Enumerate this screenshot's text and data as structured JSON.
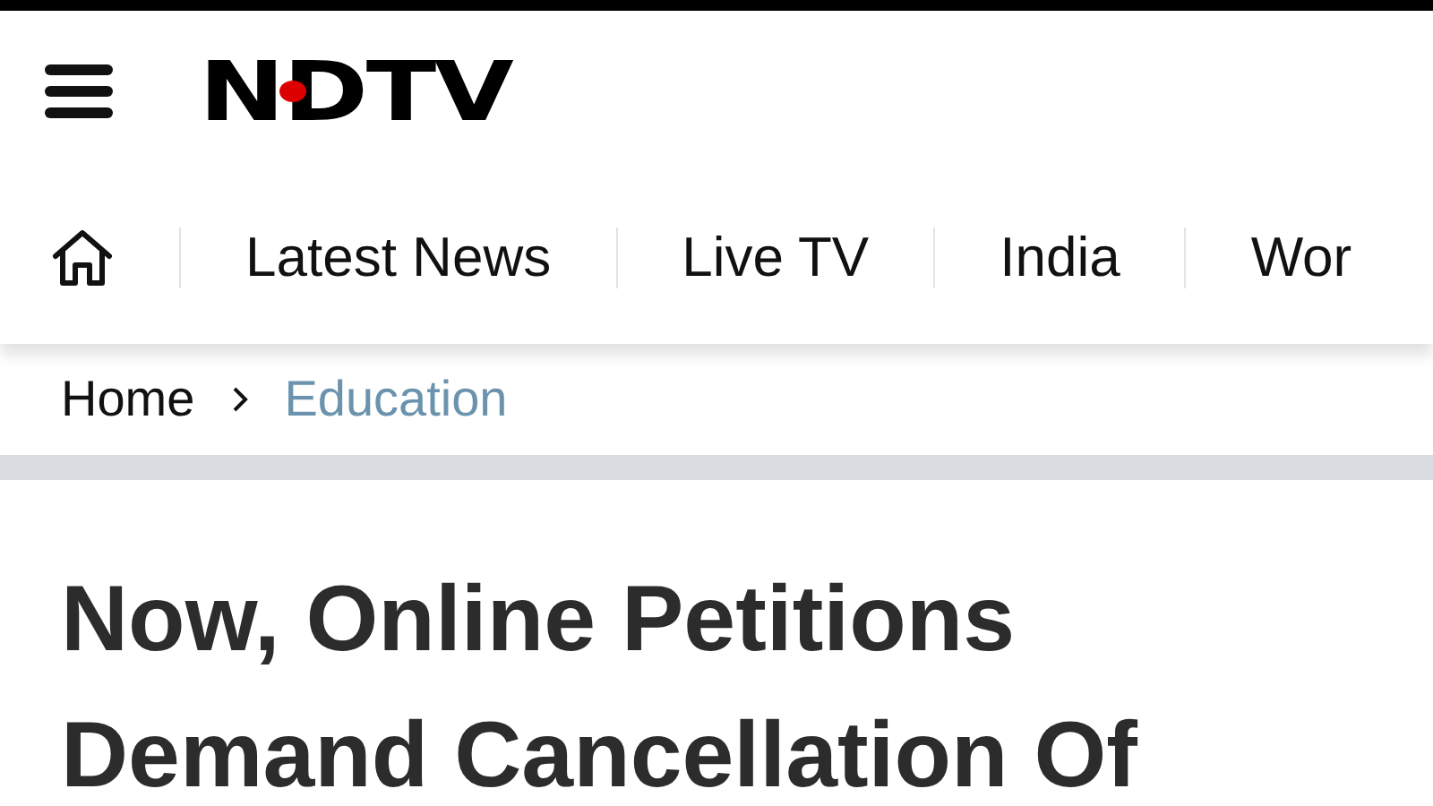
{
  "header": {
    "logo": "NDTV"
  },
  "nav": {
    "items": [
      {
        "label": "Latest News"
      },
      {
        "label": "Live TV"
      },
      {
        "label": "India"
      },
      {
        "label": "Wor"
      }
    ]
  },
  "breadcrumb": [
    {
      "label": "Home",
      "kind": "link"
    },
    {
      "label": "Education",
      "kind": "current"
    }
  ],
  "article": {
    "headline": "Now, Online Petitions Demand Cancellation Of"
  }
}
